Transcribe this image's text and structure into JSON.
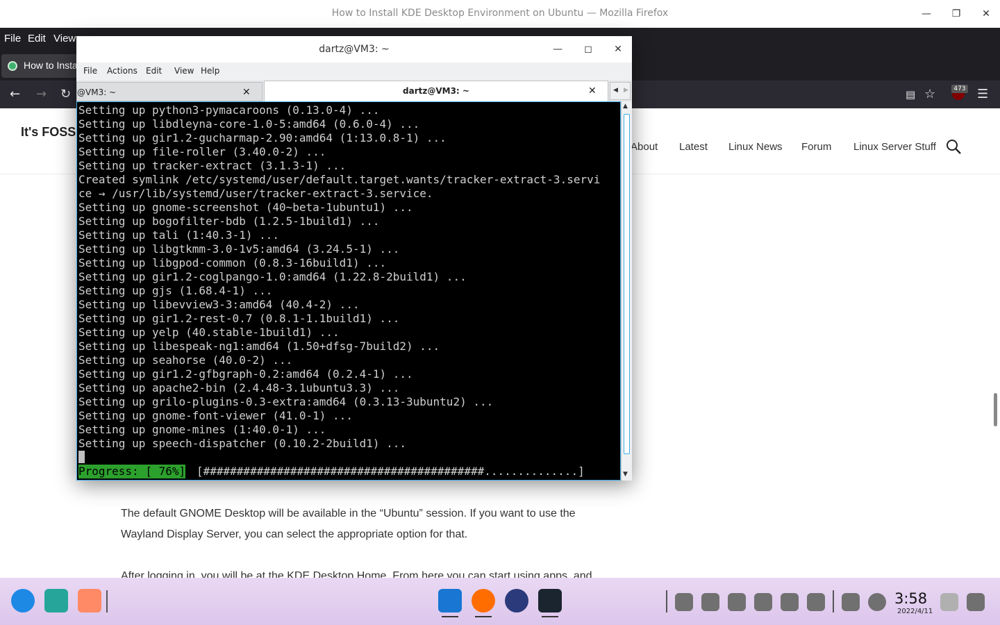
{
  "firefox": {
    "window_title": "How to Install KDE Desktop Environment on Ubuntu — Mozilla Firefox",
    "menu": [
      "File",
      "Edit",
      "View"
    ],
    "tab_label": "How to Insta",
    "ublock_count": "473"
  },
  "site": {
    "logo": "It's FOSS",
    "nav": [
      "About",
      "Latest",
      "Linux News",
      "Forum",
      "Linux Server Stuff"
    ],
    "paragraph1": "The default GNOME Desktop will be available in the “Ubuntu” session. If you want to use the Wayland Display Server, you can select the appropriate option for that.",
    "paragraph2": "After logging in, you will be at the KDE Desktop Home. From here you can start using apps, and"
  },
  "konsole": {
    "title": "dartz@VM3: ~",
    "menu": [
      "File",
      "Actions",
      "Edit",
      "View",
      "Help"
    ],
    "tab1": "@VM3: ~",
    "tab2": "dartz@VM3: ~",
    "lines": [
      "Setting up python3-pymacaroons (0.13.0-4) ...",
      "Setting up libdleyna-core-1.0-5:amd64 (0.6.0-4) ...",
      "Setting up gir1.2-gucharmap-2.90:amd64 (1:13.0.8-1) ...",
      "Setting up file-roller (3.40.0-2) ...",
      "Setting up tracker-extract (3.1.3-1) ...",
      "Created symlink /etc/systemd/user/default.target.wants/tracker-extract-3.servi",
      "ce → /usr/lib/systemd/user/tracker-extract-3.service.",
      "Setting up gnome-screenshot (40~beta-1ubuntu1) ...",
      "Setting up bogofilter-bdb (1.2.5-1build1) ...",
      "Setting up tali (1:40.3-1) ...",
      "Setting up libgtkmm-3.0-1v5:amd64 (3.24.5-1) ...",
      "Setting up libgpod-common (0.8.3-16build1) ...",
      "Setting up gir1.2-coglpango-1.0:amd64 (1.22.8-2build1) ...",
      "Setting up gjs (1.68.4-1) ...",
      "Setting up libevview3-3:amd64 (40.4-2) ...",
      "Setting up gir1.2-rest-0.7 (0.8.1-1.1build1) ...",
      "Setting up yelp (40.stable-1build1) ...",
      "Setting up libespeak-ng1:amd64 (1.50+dfsg-7build2) ...",
      "Setting up seahorse (40.0-2) ...",
      "Setting up gir1.2-gfbgraph-0.2:amd64 (0.2.4-1) ...",
      "Setting up apache2-bin (2.4.48-3.1ubuntu3.3) ...",
      "Setting up grilo-plugins-0.3-extra:amd64 (0.3.13-3ubuntu2) ...",
      "Setting up gnome-font-viewer (41.0-1) ...",
      "Setting up gnome-mines (1:40.0-1) ...",
      "Setting up speech-dispatcher (0.10.2-2build1) ..."
    ],
    "progress_label": "Progress: [ 76%]",
    "progress_bar": "[##########################################..............]",
    "progress_fraction": 0.76
  },
  "taskbar": {
    "time": "3:58",
    "date": "2022/4/11"
  }
}
